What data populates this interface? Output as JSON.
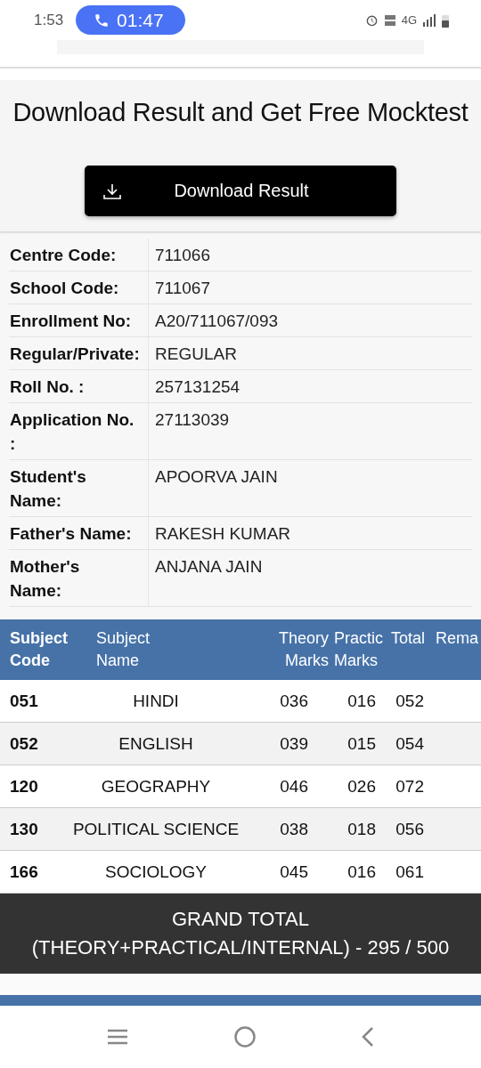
{
  "status_bar": {
    "time": "1:53",
    "call_timer": "01:47",
    "network": "4G"
  },
  "title": "Download Result and Get Free Mocktest",
  "download_button": {
    "label": "Download Result"
  },
  "details": [
    {
      "label": "Centre Code:",
      "value": "711066"
    },
    {
      "label": "School Code:",
      "value": "711067"
    },
    {
      "label": "Enrollment No:",
      "value": "A20/711067/093"
    },
    {
      "label": "Regular/Private:",
      "value": "REGULAR"
    },
    {
      "label": "Roll No. :",
      "value": "257131254"
    },
    {
      "label": "Application No.\n:",
      "value": "27113039"
    },
    {
      "label": "Student's\nName:",
      "value": "APOORVA JAIN"
    },
    {
      "label": "Father's Name:",
      "value": "RAKESH KUMAR"
    },
    {
      "label": "Mother's\nName:",
      "value": "ANJANA JAIN"
    }
  ],
  "marks_table": {
    "columns": [
      "Subject Code",
      "Subject Name",
      "Theory Marks",
      "Practic Marks",
      "Total",
      "Rema"
    ],
    "rows": [
      [
        "051",
        "HINDI",
        "036",
        "016",
        "052"
      ],
      [
        "052",
        "ENGLISH",
        "039",
        "015",
        "054"
      ],
      [
        "120",
        "GEOGRAPHY",
        "046",
        "026",
        "072"
      ],
      [
        "130",
        "POLITICAL SCIENCE",
        "038",
        "018",
        "056"
      ],
      [
        "166",
        "SOCIOLOGY",
        "045",
        "016",
        "061"
      ]
    ]
  },
  "grand_total": {
    "heading": "GRAND TOTAL",
    "line": "(THEORY+PRACTICAL/INTERNAL) - 295 / 500"
  }
}
